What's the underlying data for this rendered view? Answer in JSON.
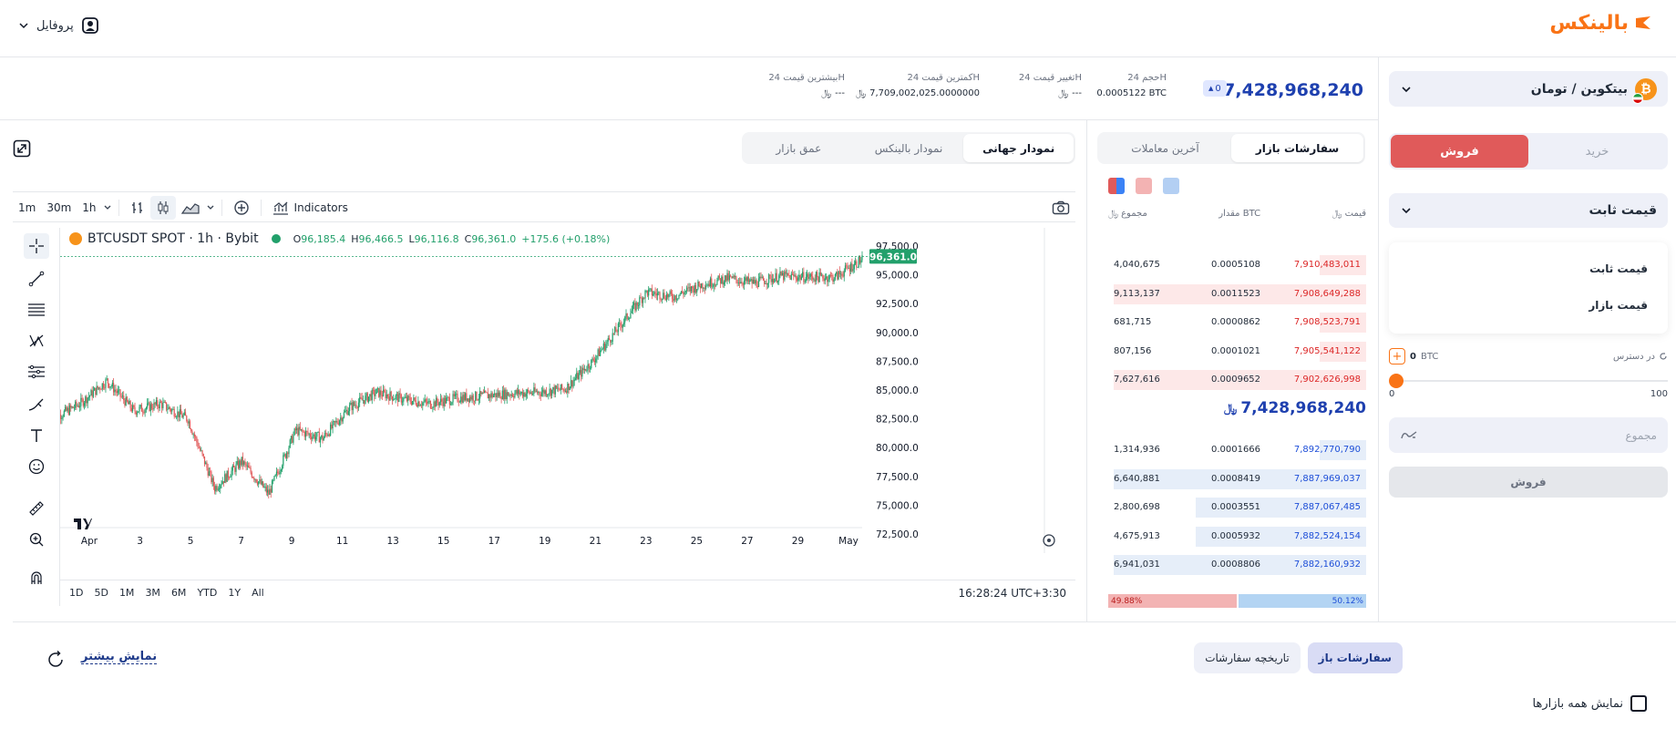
{
  "header": {
    "brand": "بالینکس",
    "profile_label": "پروفایل"
  },
  "market": {
    "pair": "بیتکوین / تومان",
    "last_price": "7,428,968,240",
    "change_badge": "0",
    "stats": [
      {
        "label": "حجم 24H",
        "value": "0.0005122 BTC"
      },
      {
        "label": "تغییر قیمت 24H",
        "value": "---"
      },
      {
        "label": "کمترین قیمت 24H",
        "value": "7,709,002,025.0000000"
      },
      {
        "label": "بیشترین قیمت 24H",
        "value": "---"
      }
    ]
  },
  "trade": {
    "buy_label": "خرید",
    "sell_label": "فروش",
    "order_type": "قیمت ثابت",
    "order_type_options": [
      "قیمت ثابت",
      "قیمت بازار"
    ],
    "available_label": "در دسترس",
    "available_value": "0",
    "available_unit": "BTC",
    "slider_min": "0",
    "slider_max": "100",
    "slider_value": 0,
    "total_placeholder": "مجموع",
    "submit_label": "فروش"
  },
  "orderbook": {
    "tabs": [
      "سفارشات بازار",
      "آخرین معاملات"
    ],
    "col_price": "قیمت",
    "col_amount": "مقدار BTC",
    "col_total": "مجموع",
    "asks": [
      {
        "price": "7,910,483,011",
        "amount": "0.0005108",
        "total": "4,040,675",
        "depth": 0.18
      },
      {
        "price": "7,908,649,288",
        "amount": "0.0011523",
        "total": "9,113,137",
        "depth": 0.98
      },
      {
        "price": "7,908,523,791",
        "amount": "0.0000862",
        "total": "681,715",
        "depth": 0.18
      },
      {
        "price": "7,905,541,122",
        "amount": "0.0001021",
        "total": "807,156",
        "depth": 0.18
      },
      {
        "price": "7,902,626,998",
        "amount": "0.0009652",
        "total": "7,627,616",
        "depth": 0.98
      }
    ],
    "mid_price": "7,428,968,240",
    "bids": [
      {
        "price": "7,892,770,790",
        "amount": "0.0001666",
        "total": "1,314,936",
        "depth": 0.18
      },
      {
        "price": "7,887,969,037",
        "amount": "0.0008419",
        "total": "6,640,881",
        "depth": 0.98
      },
      {
        "price": "7,887,067,485",
        "amount": "0.0003551",
        "total": "2,800,698",
        "depth": 0.66
      },
      {
        "price": "7,882,524,154",
        "amount": "0.0005932",
        "total": "4,675,913",
        "depth": 0.66
      },
      {
        "price": "7,882,160,932",
        "amount": "0.0008806",
        "total": "6,941,031",
        "depth": 0.98
      }
    ],
    "sell_ratio": "49.88%",
    "buy_ratio": "50.12%",
    "sell_ratio_value": 49.88,
    "buy_ratio_value": 50.12
  },
  "chart": {
    "tabs": [
      "نمودار جهانی",
      "نمودار بالینکس",
      "عمق بازار"
    ],
    "intervals": [
      "1m",
      "30m",
      "1h"
    ],
    "indicators_label": "Indicators",
    "symbol": "BTCUSDT SPOT · 1h · Bybit",
    "ohlc": {
      "o": "96,185.4",
      "h": "96,466.5",
      "l": "96,116.8",
      "c": "96,361.0",
      "chg": "+175.6 (+0.18%)"
    },
    "price_tag": "96,361.0",
    "ranges": [
      "1D",
      "5D",
      "1M",
      "3M",
      "6M",
      "YTD",
      "1Y",
      "All"
    ],
    "clock": "16:28:24 UTC+3:30"
  },
  "chart_data": {
    "type": "line",
    "title": "BTCUSDT SPOT · 1h · Bybit",
    "x_ticks": [
      "Apr",
      "3",
      "5",
      "7",
      "9",
      "11",
      "13",
      "15",
      "17",
      "19",
      "21",
      "23",
      "25",
      "27",
      "29",
      "May"
    ],
    "y_ticks": [
      "97,500.0",
      "95,000.0",
      "92,500.0",
      "90,000.0",
      "87,500.0",
      "85,000.0",
      "82,500.0",
      "80,000.0",
      "77,500.0",
      "75,000.0",
      "72,500.0"
    ],
    "ylim": [
      72500,
      97500
    ],
    "x": [
      "Apr 1",
      "Apr 2",
      "Apr 3",
      "Apr 4",
      "Apr 5",
      "Apr 6",
      "Apr 7",
      "Apr 8",
      "Apr 9",
      "Apr 10",
      "Apr 11",
      "Apr 12",
      "Apr 13",
      "Apr 14",
      "Apr 15",
      "Apr 16",
      "Apr 17",
      "Apr 18",
      "Apr 19",
      "Apr 20",
      "Apr 21",
      "Apr 22",
      "Apr 23",
      "Apr 24",
      "Apr 25",
      "Apr 26",
      "Apr 27",
      "Apr 28",
      "Apr 29",
      "Apr 30",
      "May 1"
    ],
    "close": [
      82500,
      83800,
      85800,
      83200,
      83800,
      82500,
      76500,
      78800,
      76000,
      81500,
      80800,
      83500,
      84800,
      84200,
      83800,
      84300,
      84500,
      84700,
      84800,
      85100,
      87500,
      90500,
      93500,
      93100,
      94100,
      94700,
      94300,
      94900,
      94800,
      94800,
      96361
    ]
  },
  "footer": {
    "tab_open": "سفارشات باز",
    "tab_history": "تاریخچه سفارشات",
    "show_more": "نمایش بیشتر",
    "show_all_markets": "نمایش همه بازارها"
  },
  "colors": {
    "brand": "#f97316",
    "sell": "#e05a5a",
    "ask_text": "#dc2626",
    "bid_text": "#1d4ed8",
    "ask_bg": "#fde8e8",
    "bid_bg": "#e6eef9",
    "candle_up": "#22a06b",
    "candle_down": "#e05a5a"
  }
}
